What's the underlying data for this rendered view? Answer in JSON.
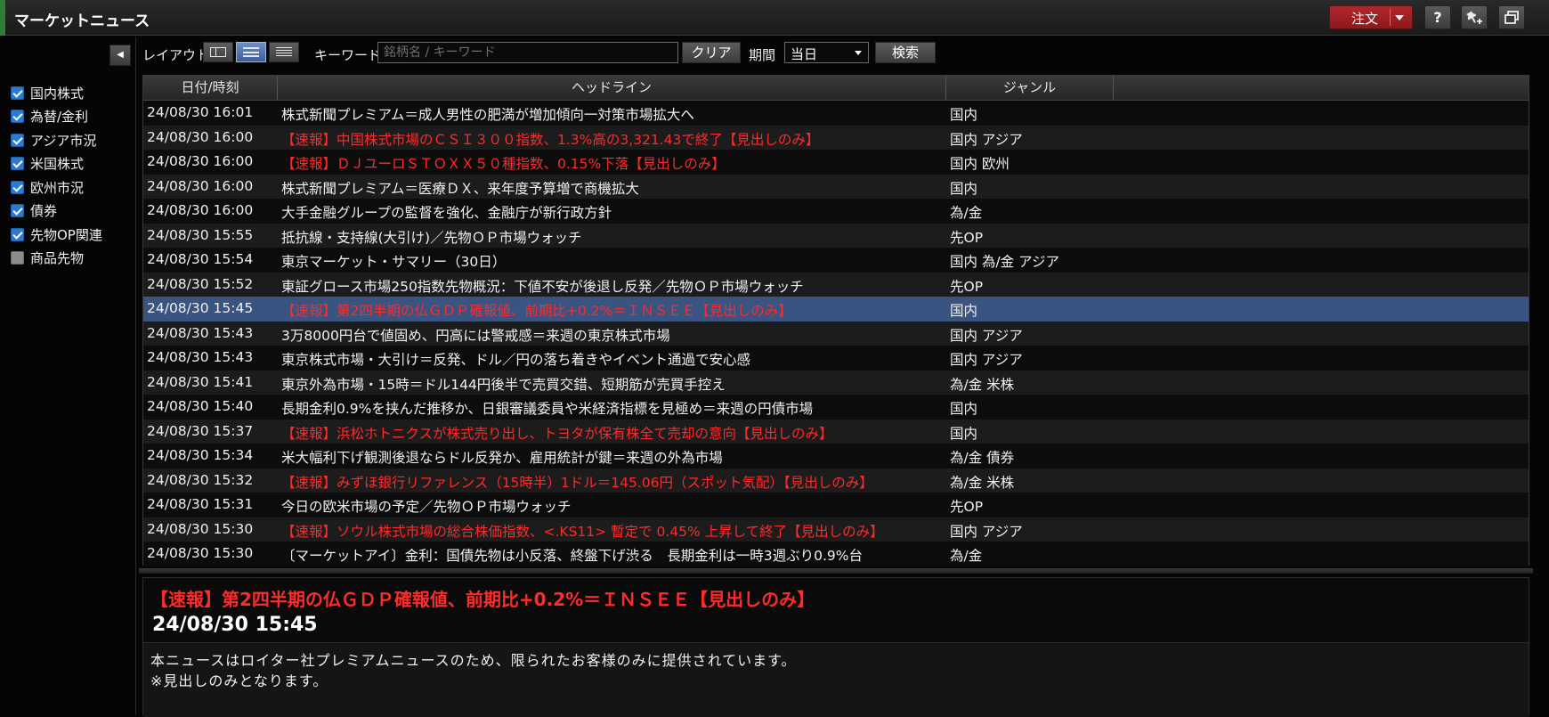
{
  "window": {
    "title": "マーケットニュース",
    "order_label": "注文",
    "help_label": "?"
  },
  "sidebar": {
    "genres": [
      {
        "label": "国内株式",
        "checked": true
      },
      {
        "label": "為替/金利",
        "checked": true
      },
      {
        "label": "アジア市況",
        "checked": true
      },
      {
        "label": "米国株式",
        "checked": true
      },
      {
        "label": "欧州市況",
        "checked": true
      },
      {
        "label": "債券",
        "checked": true
      },
      {
        "label": "先物OP関連",
        "checked": true
      },
      {
        "label": "商品先物",
        "checked": false
      }
    ]
  },
  "toolbar": {
    "layout_label": "レイアウト",
    "keyword_label": "キーワード",
    "keyword_placeholder": "銘柄名 / キーワード",
    "keyword_value": "",
    "clear_label": "クリア",
    "period_label": "期間",
    "period_value": "当日",
    "search_label": "検索"
  },
  "table": {
    "columns": [
      "日付/時刻",
      "ヘッドライン",
      "ジャンル"
    ],
    "rows": [
      {
        "date": "24/08/30 16:01",
        "headline": "株式新聞プレミアム＝成人男性の肥満が増加傾向一対策市場拡大へ",
        "genre": "国内",
        "red": false
      },
      {
        "date": "24/08/30 16:00",
        "headline": "【速報】中国株式市場のＣＳＩ３００指数、1.3%高の3,321.43で終了【見出しのみ】",
        "genre": "国内 アジア",
        "red": true
      },
      {
        "date": "24/08/30 16:00",
        "headline": "【速報】ＤＪユーロＳＴＯＸＸ５０種指数、0.15%下落【見出しのみ】",
        "genre": "国内 欧州",
        "red": true
      },
      {
        "date": "24/08/30 16:00",
        "headline": "株式新聞プレミアム＝医療ＤＸ、来年度予算増で商機拡大",
        "genre": "国内",
        "red": false
      },
      {
        "date": "24/08/30 16:00",
        "headline": "大手金融グループの監督を強化、金融庁が新行政方針",
        "genre": "為/金",
        "red": false
      },
      {
        "date": "24/08/30 15:55",
        "headline": "抵抗線・支持線(大引け)／先物ＯＰ市場ウォッチ",
        "genre": "先OP",
        "red": false
      },
      {
        "date": "24/08/30 15:54",
        "headline": "東京マーケット・サマリー（30日）",
        "genre": "国内 為/金 アジア",
        "red": false
      },
      {
        "date": "24/08/30 15:52",
        "headline": "東証グロース市場250指数先物概況：下値不安が後退し反発／先物ＯＰ市場ウォッチ",
        "genre": "先OP",
        "red": false
      },
      {
        "date": "24/08/30 15:45",
        "headline": "【速報】第2四半期の仏ＧＤＰ確報値、前期比+0.2%＝ＩＮＳＥＥ【見出しのみ】",
        "genre": "国内",
        "red": true,
        "selected": true
      },
      {
        "date": "24/08/30 15:43",
        "headline": "3万8000円台で値固め、円高には警戒感＝来週の東京株式市場",
        "genre": "国内 アジア",
        "red": false
      },
      {
        "date": "24/08/30 15:43",
        "headline": "東京株式市場・大引け＝反発、ドル／円の落ち着きやイベント通過で安心感",
        "genre": "国内 アジア",
        "red": false
      },
      {
        "date": "24/08/30 15:41",
        "headline": "東京外為市場・15時＝ドル144円後半で売買交錯、短期筋が売買手控え",
        "genre": "為/金 米株",
        "red": false
      },
      {
        "date": "24/08/30 15:40",
        "headline": "長期金利0.9%を挟んだ推移か、日銀審議委員や米経済指標を見極め＝来週の円債市場",
        "genre": "国内",
        "red": false
      },
      {
        "date": "24/08/30 15:37",
        "headline": "【速報】浜松ホトニクスが株式売り出し、トヨタが保有株全て売却の意向【見出しのみ】",
        "genre": "国内",
        "red": true
      },
      {
        "date": "24/08/30 15:34",
        "headline": "米大幅利下げ観測後退ならドル反発か、雇用統計が鍵＝来週の外為市場",
        "genre": "為/金 債券",
        "red": false
      },
      {
        "date": "24/08/30 15:32",
        "headline": "【速報】みずほ銀行リファレンス（15時半）1ドル＝145.06円（スポット気配）【見出しのみ】",
        "genre": "為/金 米株",
        "red": true
      },
      {
        "date": "24/08/30 15:31",
        "headline": "今日の欧米市場の予定／先物ＯＰ市場ウォッチ",
        "genre": "先OP",
        "red": false
      },
      {
        "date": "24/08/30 15:30",
        "headline": "【速報】ソウル株式市場の総合株価指数、<.KS11> 暫定で 0.45% 上昇して終了【見出しのみ】",
        "genre": "国内 アジア",
        "red": true
      },
      {
        "date": "24/08/30 15:30",
        "headline": "〔マーケットアイ〕金利：国債先物は小反落、終盤下げ渋る　長期金利は一時3週ぶり0.9%台",
        "genre": "為/金",
        "red": false
      }
    ]
  },
  "detail": {
    "title": "【速報】第2四半期の仏ＧＤＰ確報値、前期比+0.2%＝ＩＮＳＥＥ【見出しのみ】",
    "datetime": "24/08/30 15:45",
    "body_line1": "本ニュースはロイター社プレミアムニュースのため、限られたお客様のみに提供されています。",
    "body_line2": "※見出しのみとなります。"
  },
  "colors": {
    "accent_red": "#ff2a2a",
    "selection": "#3a5482",
    "checkbox_blue": "#2b7ad1"
  }
}
